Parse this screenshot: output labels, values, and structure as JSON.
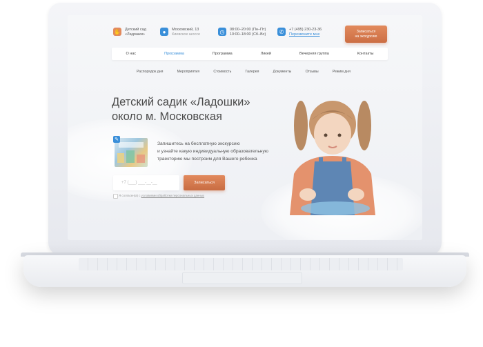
{
  "header": {
    "logo_line1": "Детский сад",
    "logo_line2": "«Ладошки»",
    "address_line1": "Московский, 13",
    "address_line2": "Киевское шоссе",
    "hours_line1": "08:00–20:00 (Пн–Пт)",
    "hours_line2": "10:00–18:00 (Сб–Вс)",
    "phone": "+7 (495) 230-23-36",
    "callback_link": "Перезвоните мне",
    "cta_line1": "Записаться",
    "cta_line2": "на экскурсию"
  },
  "nav_primary": {
    "items": [
      "О нас",
      "Программа",
      "Программа",
      "Ликей",
      "Вечерняя группа",
      "Контакты"
    ]
  },
  "nav_secondary": {
    "items": [
      "Распорядок дня",
      "Мероприятия",
      "Стоимость",
      "Галерея",
      "Документы",
      "Отзывы",
      "Режим дня"
    ]
  },
  "hero": {
    "title_line1": "Детский садик «Ладошки»",
    "title_line2": "около м. Московская",
    "promo_line1": "Запишитесь на бесплатную экскурсию",
    "promo_line2": "и узнайте какую индивидуальную образовательную",
    "promo_line3": "траекторию мы построим для Вашего ребенка",
    "phone_placeholder": "+7 (___) ___-__-__",
    "submit_label": "Записаться",
    "consent_text": "Я согласен(а) с",
    "consent_link": "условиями обработки персональных данных"
  },
  "colors": {
    "accent": "#d6774a",
    "link": "#3a8fd9",
    "text": "#4a4a4a"
  }
}
